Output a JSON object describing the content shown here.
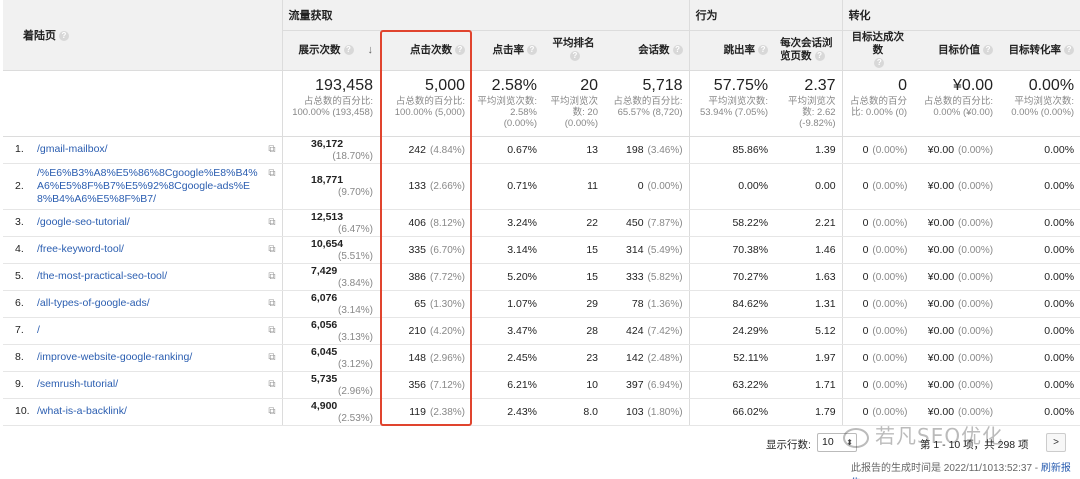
{
  "groups": {
    "traffic": "流量获取",
    "behavior": "行为",
    "conversion": "转化"
  },
  "columns": {
    "landing_page": "着陆页",
    "impressions": "展示次数",
    "clicks": "点击次数",
    "ctr": "点击率",
    "avg_position": "平均排名",
    "sessions": "会话数",
    "bounce_rate": "跳出率",
    "pages_per_session": "每次会话浏览页数",
    "goal_completions": "目标达成次数",
    "goal_value": "目标价值",
    "goal_conv_rate": "目标转化率"
  },
  "totals": {
    "impressions": {
      "value": "193,458",
      "sub": "占总数的百分比: 100.00% (193,458)"
    },
    "clicks": {
      "value": "5,000",
      "sub": "占总数的百分比: 100.00% (5,000)"
    },
    "ctr": {
      "value": "2.58%",
      "sub": "平均浏览次数: 2.58% (0.00%)"
    },
    "avg_position": {
      "value": "20",
      "sub": "平均浏览次数: 20 (0.00%)"
    },
    "sessions": {
      "value": "5,718",
      "sub": "占总数的百分比: 65.57% (8,720)"
    },
    "bounce_rate": {
      "value": "57.75%",
      "sub": "平均浏览次数: 53.94% (7.05%)"
    },
    "pages_per_session": {
      "value": "2.37",
      "sub": "平均浏览次数: 2.62 (-9.82%)"
    },
    "goal_completions": {
      "value": "0",
      "sub": "占总数的百分比: 0.00% (0)"
    },
    "goal_value": {
      "value": "¥0.00",
      "sub": "占总数的百分比: 0.00% (¥0.00)"
    },
    "goal_conv_rate": {
      "value": "0.00%",
      "sub": "平均浏览次数: 0.00% (0.00%)"
    }
  },
  "rows": [
    {
      "n": "1.",
      "page": "/gmail-mailbox/",
      "imp": "36,172",
      "imp_pct": "(18.70%)",
      "clk": "242",
      "clk_pct": "(4.84%)",
      "ctr": "0.67%",
      "pos": "13",
      "ses": "198",
      "ses_pct": "(3.46%)",
      "bounce": "85.86%",
      "pps": "1.39",
      "goal": "0",
      "goal_pct": "(0.00%)",
      "val": "¥0.00",
      "val_pct": "(0.00%)",
      "conv": "0.00%"
    },
    {
      "n": "2.",
      "page": "/%E6%B3%A8%E5%86%8Cgoogle%E8%B4%A6%E5%8F%B7%E5%92%8Cgoogle-ads%E8%B4%A6%E5%8F%B7/",
      "imp": "18,771",
      "imp_pct": "(9.70%)",
      "clk": "133",
      "clk_pct": "(2.66%)",
      "ctr": "0.71%",
      "pos": "11",
      "ses": "0",
      "ses_pct": "(0.00%)",
      "bounce": "0.00%",
      "pps": "0.00",
      "goal": "0",
      "goal_pct": "(0.00%)",
      "val": "¥0.00",
      "val_pct": "(0.00%)",
      "conv": "0.00%"
    },
    {
      "n": "3.",
      "page": "/google-seo-tutorial/",
      "imp": "12,513",
      "imp_pct": "(6.47%)",
      "clk": "406",
      "clk_pct": "(8.12%)",
      "ctr": "3.24%",
      "pos": "22",
      "ses": "450",
      "ses_pct": "(7.87%)",
      "bounce": "58.22%",
      "pps": "2.21",
      "goal": "0",
      "goal_pct": "(0.00%)",
      "val": "¥0.00",
      "val_pct": "(0.00%)",
      "conv": "0.00%"
    },
    {
      "n": "4.",
      "page": "/free-keyword-tool/",
      "imp": "10,654",
      "imp_pct": "(5.51%)",
      "clk": "335",
      "clk_pct": "(6.70%)",
      "ctr": "3.14%",
      "pos": "15",
      "ses": "314",
      "ses_pct": "(5.49%)",
      "bounce": "70.38%",
      "pps": "1.46",
      "goal": "0",
      "goal_pct": "(0.00%)",
      "val": "¥0.00",
      "val_pct": "(0.00%)",
      "conv": "0.00%"
    },
    {
      "n": "5.",
      "page": "/the-most-practical-seo-tool/",
      "imp": "7,429",
      "imp_pct": "(3.84%)",
      "clk": "386",
      "clk_pct": "(7.72%)",
      "ctr": "5.20%",
      "pos": "15",
      "ses": "333",
      "ses_pct": "(5.82%)",
      "bounce": "70.27%",
      "pps": "1.63",
      "goal": "0",
      "goal_pct": "(0.00%)",
      "val": "¥0.00",
      "val_pct": "(0.00%)",
      "conv": "0.00%"
    },
    {
      "n": "6.",
      "page": "/all-types-of-google-ads/",
      "imp": "6,076",
      "imp_pct": "(3.14%)",
      "clk": "65",
      "clk_pct": "(1.30%)",
      "ctr": "1.07%",
      "pos": "29",
      "ses": "78",
      "ses_pct": "(1.36%)",
      "bounce": "84.62%",
      "pps": "1.31",
      "goal": "0",
      "goal_pct": "(0.00%)",
      "val": "¥0.00",
      "val_pct": "(0.00%)",
      "conv": "0.00%"
    },
    {
      "n": "7.",
      "page": "/",
      "imp": "6,056",
      "imp_pct": "(3.13%)",
      "clk": "210",
      "clk_pct": "(4.20%)",
      "ctr": "3.47%",
      "pos": "28",
      "ses": "424",
      "ses_pct": "(7.42%)",
      "bounce": "24.29%",
      "pps": "5.12",
      "goal": "0",
      "goal_pct": "(0.00%)",
      "val": "¥0.00",
      "val_pct": "(0.00%)",
      "conv": "0.00%"
    },
    {
      "n": "8.",
      "page": "/improve-website-google-ranking/",
      "imp": "6,045",
      "imp_pct": "(3.12%)",
      "clk": "148",
      "clk_pct": "(2.96%)",
      "ctr": "2.45%",
      "pos": "23",
      "ses": "142",
      "ses_pct": "(2.48%)",
      "bounce": "52.11%",
      "pps": "1.97",
      "goal": "0",
      "goal_pct": "(0.00%)",
      "val": "¥0.00",
      "val_pct": "(0.00%)",
      "conv": "0.00%"
    },
    {
      "n": "9.",
      "page": "/semrush-tutorial/",
      "imp": "5,735",
      "imp_pct": "(2.96%)",
      "clk": "356",
      "clk_pct": "(7.12%)",
      "ctr": "6.21%",
      "pos": "10",
      "ses": "397",
      "ses_pct": "(6.94%)",
      "bounce": "63.22%",
      "pps": "1.71",
      "goal": "0",
      "goal_pct": "(0.00%)",
      "val": "¥0.00",
      "val_pct": "(0.00%)",
      "conv": "0.00%"
    },
    {
      "n": "10.",
      "page": "/what-is-a-backlink/",
      "imp": "4,900",
      "imp_pct": "(2.53%)",
      "clk": "119",
      "clk_pct": "(2.38%)",
      "ctr": "2.43%",
      "pos": "8.0",
      "ses": "103",
      "ses_pct": "(1.80%)",
      "bounce": "66.02%",
      "pps": "1.79",
      "goal": "0",
      "goal_pct": "(0.00%)",
      "val": "¥0.00",
      "val_pct": "(0.00%)",
      "conv": "0.00%"
    }
  ],
  "footer": {
    "rows_label": "显示行数:",
    "rows_value": "10",
    "pager_text": "第 1 - 10 项，共 298 项",
    "next_glyph": ">",
    "generated": "此报告的生成时间是 2022/11/1013:52:37 - ",
    "refresh": "刷新报告"
  },
  "watermark": "若凡SEO优化",
  "accent": "#e0442e",
  "link_color": "#2a5db0"
}
